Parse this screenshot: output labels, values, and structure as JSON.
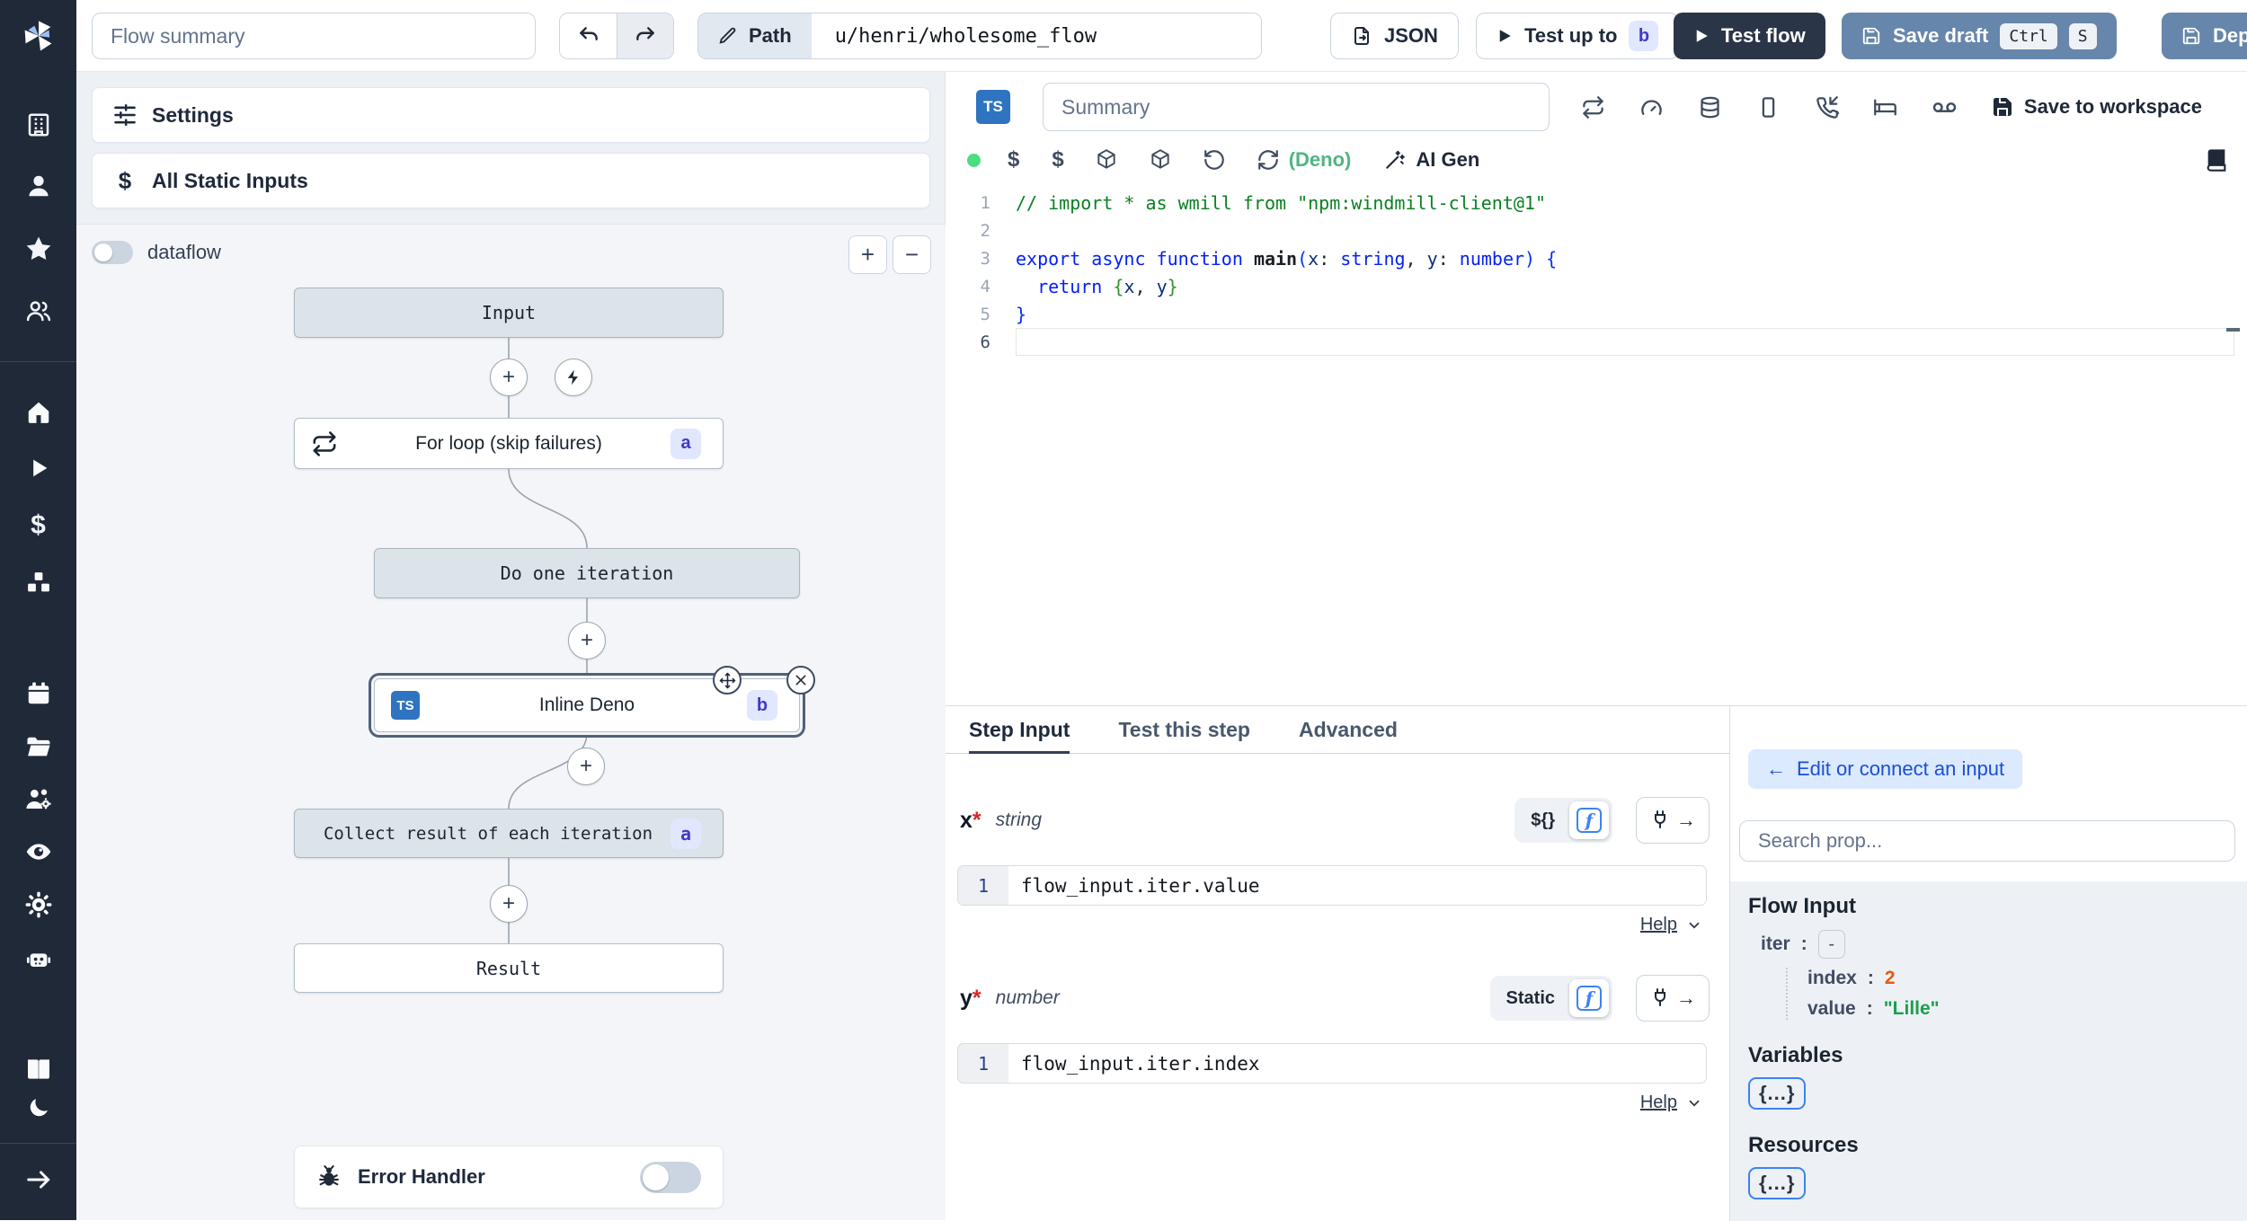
{
  "topbar": {
    "flow_summary_placeholder": "Flow summary",
    "path_label": "Path",
    "path_value": "u/henri/wholesome_flow",
    "json_label": "JSON",
    "test_up_to_label": "Test up to",
    "test_up_to_badge": "b",
    "test_flow_label": "Test flow",
    "save_draft_label": "Save draft",
    "kbd_ctrl": "Ctrl",
    "kbd_s": "S",
    "deploy_label": "Deploy"
  },
  "flow_panel": {
    "settings_label": "Settings",
    "static_inputs_label": "All Static Inputs",
    "dataflow_label": "dataflow",
    "zoom_in": "+",
    "zoom_out": "−",
    "nodes": {
      "input": {
        "label": "Input"
      },
      "forloop": {
        "label": "For loop (skip failures)",
        "badge": "a"
      },
      "do_one": {
        "label": "Do one iteration"
      },
      "inline": {
        "label": "Inline Deno",
        "badge": "b",
        "lang": "TS"
      },
      "collect": {
        "label": "Collect result of each iteration",
        "badge": "a"
      },
      "result": {
        "label": "Result"
      }
    },
    "error_handler_label": "Error Handler"
  },
  "editor": {
    "lang_badge": "TS",
    "summary_placeholder": "Summary",
    "deno_label": "(Deno)",
    "ai_gen_label": "AI Gen",
    "save_to_workspace_label": "Save to workspace",
    "code": {
      "active_line": 6,
      "lines": [
        [
          [
            "cmt",
            "// import * as wmill from \"npm:windmill-client@1\""
          ]
        ],
        [],
        [
          [
            "kw",
            "export"
          ],
          [
            "pl",
            " "
          ],
          [
            "kw",
            "async"
          ],
          [
            "pl",
            " "
          ],
          [
            "kw",
            "function"
          ],
          [
            "pl",
            " "
          ],
          [
            "fn",
            "main"
          ],
          [
            "b1",
            "("
          ],
          [
            "vr",
            "x"
          ],
          [
            "pl",
            ": "
          ],
          [
            "kw",
            "string"
          ],
          [
            "pl",
            ", "
          ],
          [
            "vr",
            "y"
          ],
          [
            "pl",
            ": "
          ],
          [
            "kw",
            "number"
          ],
          [
            "b1",
            ")"
          ],
          [
            "pl",
            " "
          ],
          [
            "b1",
            "{"
          ]
        ],
        [
          [
            "pl",
            "  "
          ],
          [
            "kw",
            "return"
          ],
          [
            "pl",
            " "
          ],
          [
            "b2",
            "{"
          ],
          [
            "vr",
            "x"
          ],
          [
            "pl",
            ", "
          ],
          [
            "vr",
            "y"
          ],
          [
            "b2",
            "}"
          ]
        ],
        [
          [
            "b1",
            "}"
          ]
        ],
        []
      ]
    }
  },
  "step_panel": {
    "tabs": [
      "Step Input",
      "Test this step",
      "Advanced"
    ],
    "x_field": {
      "name": "x",
      "required": "*",
      "type": "string",
      "mode_label": "${}",
      "line_no": "1",
      "expr": "flow_input.iter.value",
      "help_label": "Help"
    },
    "y_field": {
      "name": "y",
      "required": "*",
      "type": "number",
      "mode_label": "Static",
      "line_no": "1",
      "expr": "flow_input.iter.index",
      "help_label": "Help"
    }
  },
  "prop_panel": {
    "connect_arrow": "←",
    "connect_label": "Edit or connect an input",
    "search_placeholder": "Search prop...",
    "flow_input_title": "Flow Input",
    "iter_key": "iter",
    "iter_toggle": "-",
    "index_key": "index",
    "index_value": "2",
    "value_key": "value",
    "value_value": "\"Lille\"",
    "variables_title": "Variables",
    "variables_button": "{...}",
    "resources_title": "Resources",
    "resources_button": "{...}"
  },
  "colors": {
    "sidebar_bg": "#202938",
    "accent_blue": "#2f74c0",
    "steel_blue_button": "#6786ab",
    "dark_button": "#2b3548",
    "badge_bg": "#e0e7ff",
    "badge_text": "#4338ca",
    "deno_green": "#4fb582",
    "status_dot_green": "#4ade80",
    "value_number_orange": "#e8590c",
    "value_string_green": "#18a04b"
  }
}
